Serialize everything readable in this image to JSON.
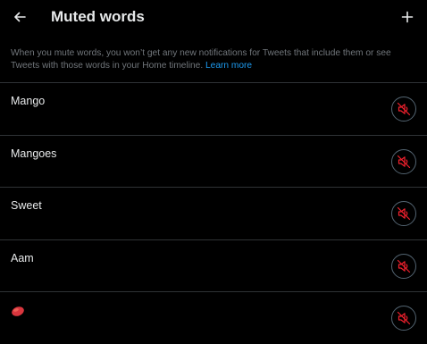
{
  "header": {
    "title": "Muted words"
  },
  "description": {
    "text": "When you mute words, you won’t get any new notifications for Tweets that include them or see Tweets with those words in your Home timeline.",
    "link": "Learn more"
  },
  "muted_words": [
    {
      "label": "Mango"
    },
    {
      "label": "Mangoes"
    },
    {
      "label": "Sweet"
    },
    {
      "label": "Aam"
    },
    {
      "label": "🥭",
      "is_emoji": true
    }
  ],
  "colors": {
    "background": "#000000",
    "text": "#e7e9ea",
    "muted_text": "#71767b",
    "link": "#1d9bf0",
    "unmute_red": "#f4212e",
    "divider": "#2f3336"
  },
  "icons": {
    "back": "arrow-left-icon",
    "add": "plus-icon",
    "unmute": "speaker-muted-icon"
  }
}
